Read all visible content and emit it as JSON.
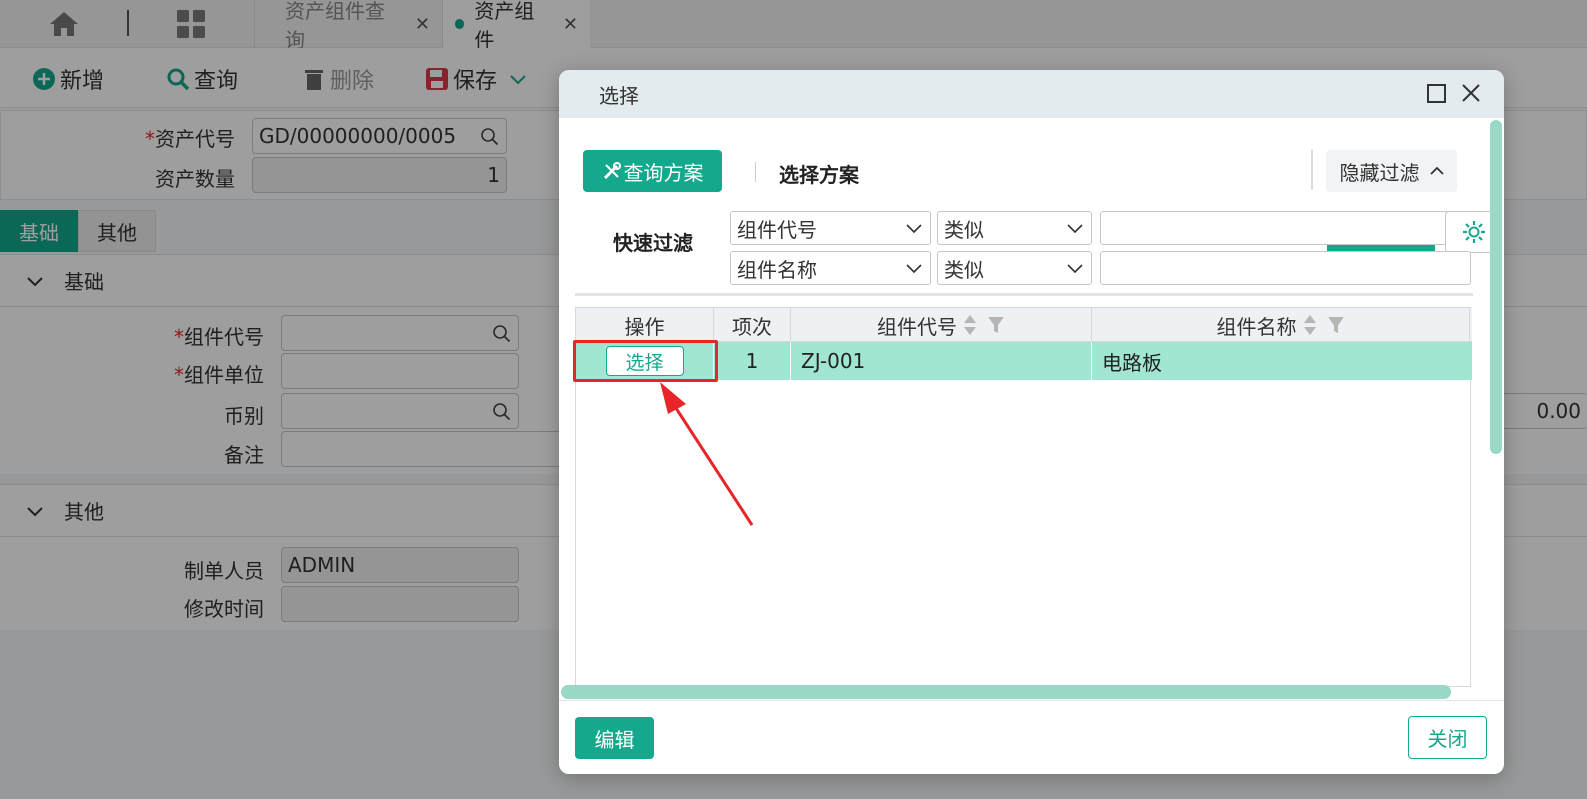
{
  "tabbar": {
    "tabs": [
      {
        "label": "资产组件查询",
        "close": "✕"
      },
      {
        "label": "资产组件",
        "close": "✕"
      }
    ]
  },
  "toolbar": {
    "new_label": "新增",
    "query_label": "查询",
    "delete_label": "删除",
    "save_label": "保存"
  },
  "form": {
    "asset_code_label": "资产代号",
    "asset_code_value": "GD/00000000/0005",
    "asset_qty_label": "资产数量",
    "asset_qty_value": "1",
    "required_mark": "*"
  },
  "subtabs": [
    "基础",
    "其他"
  ],
  "section_basic": {
    "title": "基础",
    "component_code_label": "组件代号",
    "component_unit_label": "组件单位",
    "currency_label": "币别",
    "remark_label": "备注",
    "right_value": "0.00"
  },
  "section_other": {
    "title": "其他",
    "creator_label": "制单人员",
    "creator_value": "ADMIN",
    "modified_label": "修改时间"
  },
  "dialog": {
    "title": "选择",
    "scheme_button": "查询方案",
    "scheme_label": "选择方案",
    "hide_filter_button": "隐藏过滤",
    "quick_filter_label": "快速过滤",
    "filters": [
      {
        "field": "组件代号",
        "op": "类似",
        "value": ""
      },
      {
        "field": "组件名称",
        "op": "类似",
        "value": ""
      }
    ],
    "grid": {
      "headers": [
        "操作",
        "项次",
        "组件代号",
        "组件名称"
      ],
      "rows": [
        {
          "action": "选择",
          "index": "1",
          "code": "ZJ-001",
          "name": "电路板"
        }
      ]
    },
    "edit_button": "编辑",
    "close_button": "关闭"
  },
  "colors": {
    "accent": "#14a88c",
    "row_selected": "#a1e5d3",
    "highlight": "#e8262a"
  }
}
